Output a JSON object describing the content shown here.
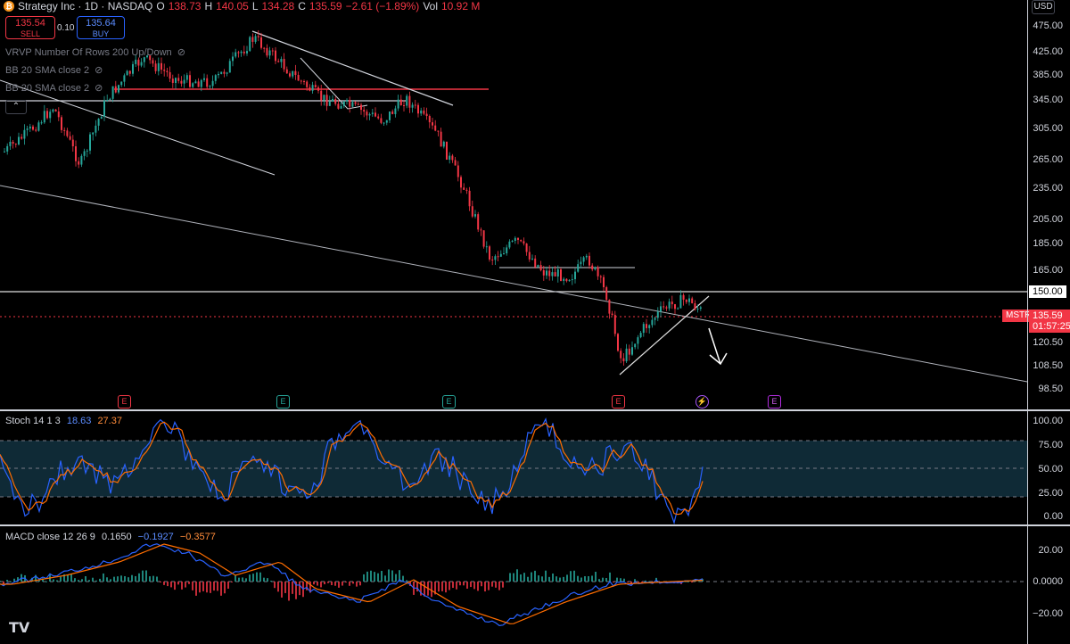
{
  "header": {
    "symbol_title": "Strategy Inc · 1D · NASDAQ",
    "o_label": "O",
    "o_value": "138.73",
    "h_label": "H",
    "h_value": "140.05",
    "l_label": "L",
    "l_value": "134.28",
    "c_label": "C",
    "c_value": "135.59",
    "change": "−2.61 (−1.89%)",
    "vol_label": "Vol",
    "vol_value": "10.92 M"
  },
  "trade": {
    "sell_price": "135.54",
    "sell_label": "SELL",
    "spread": "0.10",
    "buy_price": "135.64",
    "buy_label": "BUY"
  },
  "indicators": [
    "VRVP Number Of Rows 200 Up/Down",
    "BB 20 SMA close 2",
    "BB 20 SMA close 2"
  ],
  "collapse_glyph": "⌃",
  "currency": "USD",
  "price_axis": [
    "475.00",
    "425.00",
    "385.00",
    "345.00",
    "305.00",
    "265.00",
    "235.00",
    "205.00",
    "185.00",
    "165.00",
    "120.50",
    "108.50",
    "98.50"
  ],
  "price_tags": {
    "level_150": "150.00",
    "symbol": "MSTR",
    "current": "135.59",
    "countdown": "01:57:25"
  },
  "events": [
    {
      "glyph": "E",
      "style": "red"
    },
    {
      "glyph": "E",
      "style": "green"
    },
    {
      "glyph": "E",
      "style": "green"
    },
    {
      "glyph": "E",
      "style": "red"
    },
    {
      "glyph": "⚡",
      "style": "div"
    },
    {
      "glyph": "E",
      "style": "purple"
    }
  ],
  "stoch": {
    "title": "Stoch 14 1 3",
    "k_value": "18.63",
    "d_value": "27.37",
    "axis": [
      "100.00",
      "75.00",
      "50.00",
      "25.00",
      "0.00"
    ]
  },
  "macd": {
    "title": "MACD close 12 26 9",
    "hist_value": "0.1650",
    "macd_value": "−0.1927",
    "signal_value": "−0.3577",
    "axis": [
      "20.00",
      "0.0000",
      "−20.00"
    ]
  },
  "colors": {
    "up": "#26a69a",
    "down": "#f23645",
    "k_line": "#2962ff",
    "d_line": "#ff6d00"
  },
  "branding": "TV"
}
